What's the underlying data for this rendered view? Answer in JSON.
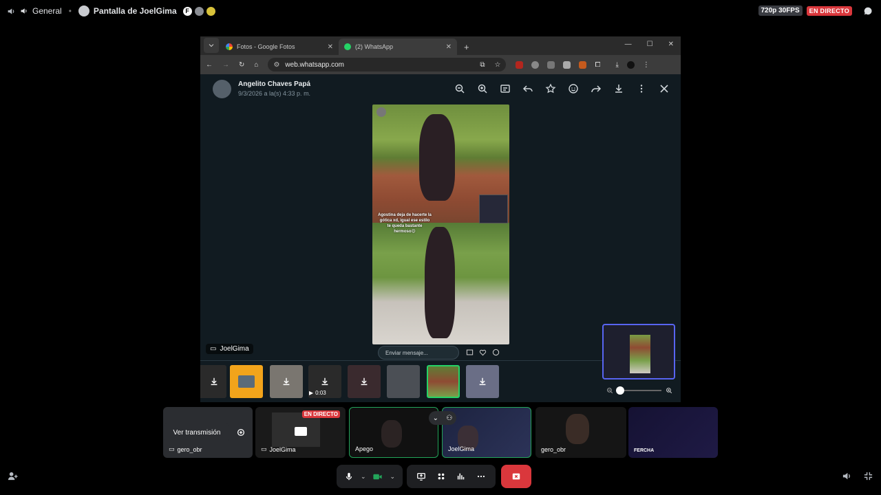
{
  "topbar": {
    "channel": "General",
    "stream_title": "Pantalla de JoelGima",
    "avatar_letter": "F",
    "quality": "720p 30FPS",
    "live": "EN DIRECTO"
  },
  "browser": {
    "tabs": [
      {
        "label": "Fotos - Google Fotos"
      },
      {
        "label": "(2) WhatsApp"
      }
    ],
    "url": "web.whatsapp.com"
  },
  "viewer": {
    "contact_name": "Angelito Chaves Papá",
    "date": "9/3/2026 a la(s) 4:33 p. m.",
    "caption": "Agostina deja de hacerte la gótica xd, igual ese estilo te queda bastante hermoso😍",
    "reply_placeholder": "Enviar mensaje...",
    "video_duration": "0:03",
    "streamer_label": "JoelGima"
  },
  "participants": [
    {
      "name": "gero_obr",
      "button": "Ver transmisión"
    },
    {
      "name": "JoelGima",
      "tag": "EN DIRECTO"
    },
    {
      "name": "Apego"
    },
    {
      "name": "JoelGima"
    },
    {
      "name": "gero_obr"
    },
    {
      "name": "FERCHA"
    }
  ],
  "colors": {
    "live_red": "#da373c",
    "speaking_green": "#23a55a",
    "whatsapp_green": "#25d366",
    "blurple": "#5865f2"
  }
}
